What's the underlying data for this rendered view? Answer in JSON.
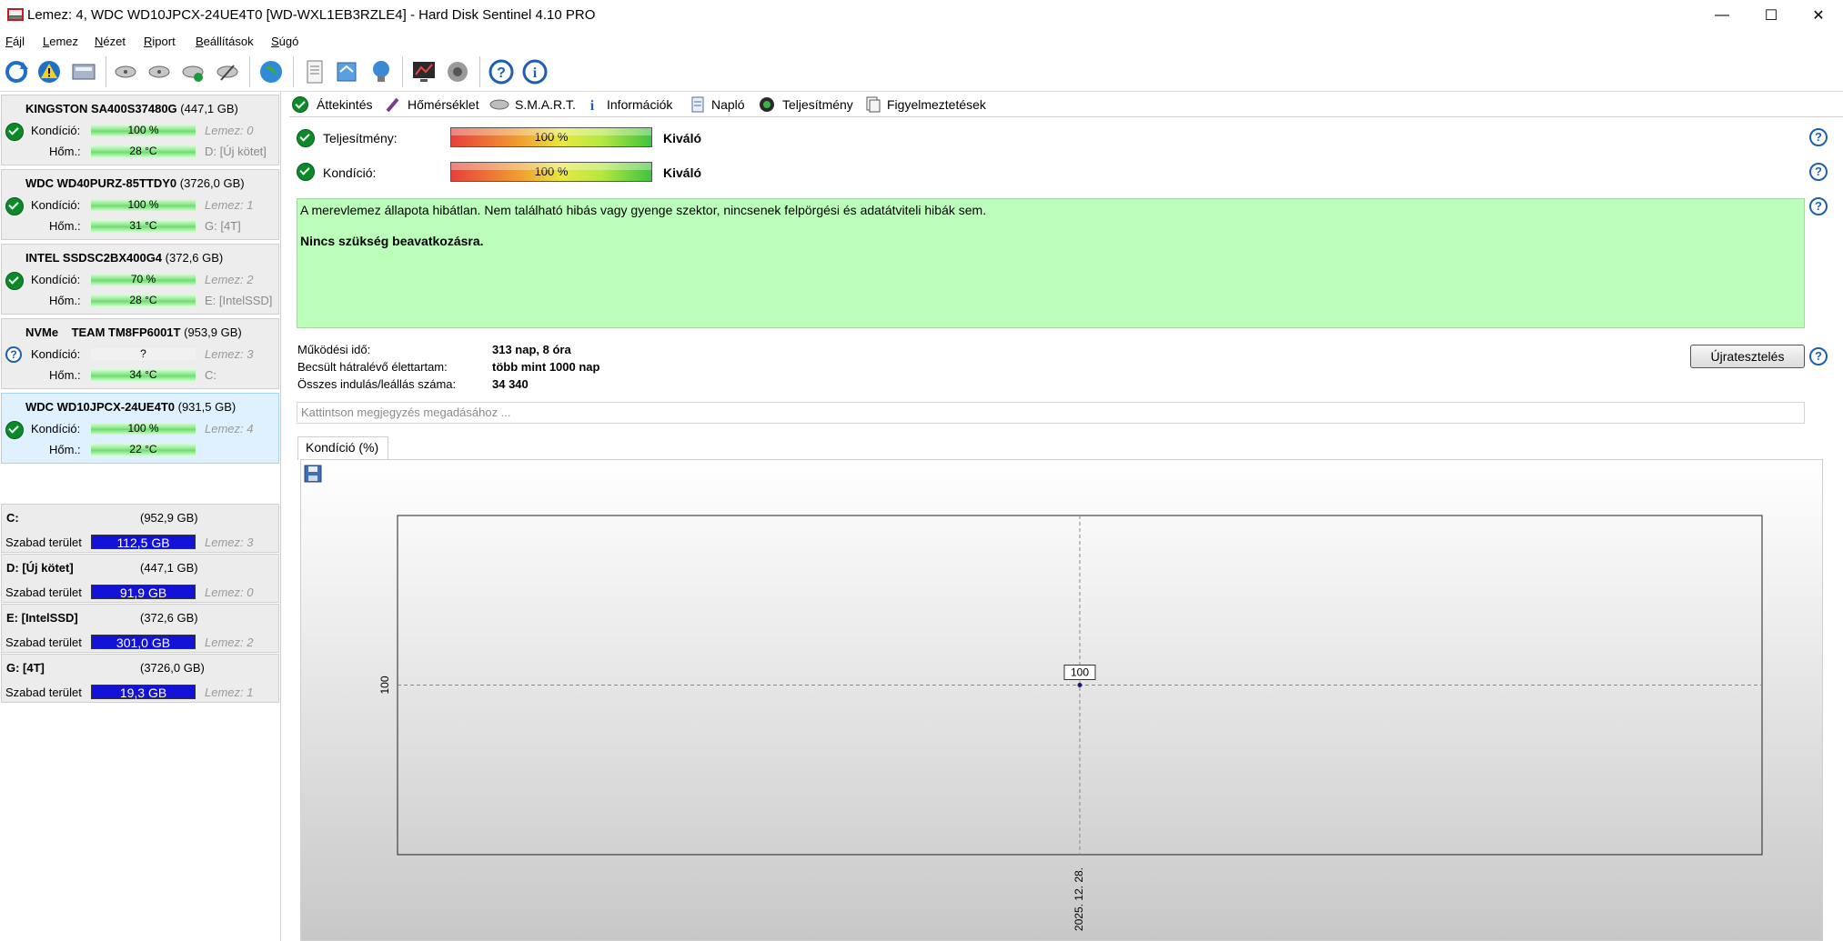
{
  "window": {
    "title": "Lemez: 4, WDC WD10JPCX-24UE4T0 [WD-WXL1EB3RZLE4]  -  Hard Disk Sentinel 4.10 PRO",
    "minimize": "—",
    "maximize": "☐",
    "close": "✕"
  },
  "menu": [
    {
      "label": "Fájl",
      "accel": "F",
      "rest": "ájl"
    },
    {
      "label": "Lemez",
      "accel": "L",
      "rest": "emez"
    },
    {
      "label": "Nézet",
      "accel": "N",
      "rest": "ézet"
    },
    {
      "label": "Riport",
      "accel": "R",
      "rest": "iport"
    },
    {
      "label": "Beállítások",
      "accel": "B",
      "rest": "eállítások"
    },
    {
      "label": "Súgó",
      "accel": "S",
      "rest": "úgó"
    }
  ],
  "disks": [
    {
      "name": "KINGSTON SA400S37480G",
      "size": "(447,1 GB)",
      "health_label": "Kondíció:",
      "health": "100 %",
      "health_pct": 100,
      "temp_label": "Hőm.:",
      "temp": "28 °C",
      "disk_no": "Lemez: 0",
      "drive": "D: [Új kötet]",
      "status": "ok"
    },
    {
      "name": "WDC WD40PURZ-85TTDY0",
      "size": "(3726,0 GB)",
      "health_label": "Kondíció:",
      "health": "100 %",
      "health_pct": 100,
      "temp_label": "Hőm.:",
      "temp": "31 °C",
      "disk_no": "Lemez: 1",
      "drive": "G: [4T]",
      "status": "ok"
    },
    {
      "name": "INTEL SSDSC2BX400G4",
      "size": "(372,6 GB)",
      "health_label": "Kondíció:",
      "health": "70 %",
      "health_pct": 70,
      "temp_label": "Hőm.:",
      "temp": "28 °C",
      "disk_no": "Lemez: 2",
      "drive": "E: [IntelSSD]",
      "status": "ok"
    },
    {
      "name": "NVMe    TEAM TM8FP6001T",
      "size": "(953,9 GB)",
      "health_label": "Kondíció:",
      "health": "?",
      "health_pct": null,
      "temp_label": "Hőm.:",
      "temp": "34 °C",
      "disk_no": "Lemez: 3",
      "drive": "C:",
      "status": "unknown"
    },
    {
      "name": "WDC WD10JPCX-24UE4T0",
      "size": "(931,5 GB)",
      "health_label": "Kondíció:",
      "health": "100 %",
      "health_pct": 100,
      "temp_label": "Hőm.:",
      "temp": "22 °C",
      "disk_no": "Lemez: 4",
      "drive": "",
      "status": "ok",
      "selected": true
    }
  ],
  "volumes": [
    {
      "name": "C:",
      "size": "(952,9 GB)",
      "free_label": "Szabad terület",
      "free": "112,5 GB",
      "used_fraction": 0.88,
      "disk_no": "Lemez: 3"
    },
    {
      "name": "D: [Új kötet]",
      "size": "(447,1 GB)",
      "free_label": "Szabad terület",
      "free": "91,9 GB",
      "used_fraction": 0.79,
      "disk_no": "Lemez: 0"
    },
    {
      "name": "E: [IntelSSD]",
      "size": "(372,6 GB)",
      "free_label": "Szabad terület",
      "free": "301,0 GB",
      "used_fraction": 0.19,
      "disk_no": "Lemez: 2"
    },
    {
      "name": "G: [4T]",
      "size": "(3726,0 GB)",
      "free_label": "Szabad terület",
      "free": "19,3 GB",
      "used_fraction": 0.995,
      "disk_no": "Lemez: 1"
    }
  ],
  "tabs": [
    "Áttekintés",
    "Hőmérséklet",
    "S.M.A.R.T.",
    "Információk",
    "Napló",
    "Teljesítmény",
    "Figyelmeztetések"
  ],
  "overview": {
    "performance_label": "Teljesítmény:",
    "performance_value": "100 %",
    "performance_pct": 100,
    "performance_rating": "Kiváló",
    "health_label": "Kondíció:",
    "health_value": "100 %",
    "health_pct": 100,
    "health_rating": "Kiváló",
    "status_line1": "A merevlemez állapota hibátlan. Nem található hibás vagy gyenge szektor, nincsenek felpörgési és adatátviteli hibák sem.",
    "status_line2": "Nincs szükség beavatkozásra.",
    "uptime_label": "Működési idő:",
    "uptime": "313 nap, 8 óra",
    "lifetime_label": "Becsült hátralévő élettartam:",
    "lifetime": "több mint 1000 nap",
    "startstop_label": "Összes indulás/leállás száma:",
    "startstop": "34 340",
    "retest_button": "Újratesztelés",
    "note_placeholder": "Kattintson megjegyzés megadásához ..."
  },
  "chart_tab": "Kondíció  (%)",
  "chart_data": {
    "type": "line",
    "x": [
      "2025. 12. 28."
    ],
    "series": [
      {
        "values": [
          100
        ]
      }
    ],
    "data_labels": [
      "100"
    ],
    "ytick_labels": [
      "100"
    ],
    "xtick_labels": [
      "2025. 12. 28."
    ],
    "grid": true
  }
}
